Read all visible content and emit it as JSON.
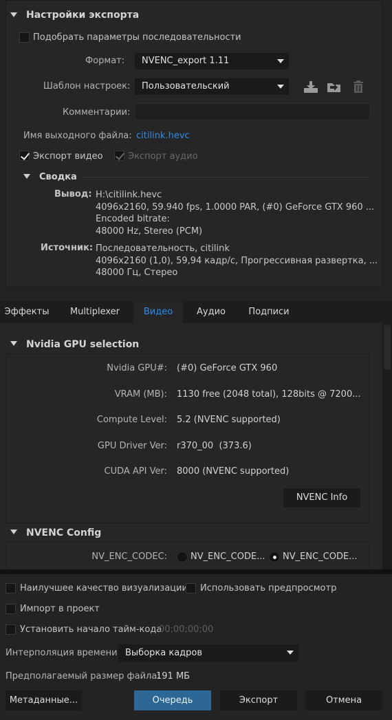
{
  "export_settings": {
    "title": "Настройки экспорта",
    "match_sequence_label": "Подобрать параметры последовательности",
    "format_label": "Формат:",
    "format_value": "NVENC_export 1.11",
    "preset_label": "Шаблон настроек:",
    "preset_value": "Пользовательский",
    "comments_label": "Комментарии:",
    "comments_value": "",
    "output_name_label": "Имя выходного файла:",
    "output_name_value": "citilink.hevc",
    "export_video_label": "Экспорт видео",
    "export_audio_label": "Экспорт аудио"
  },
  "summary": {
    "title": "Сводка",
    "output_label": "Вывод:",
    "output_lines": [
      "H:\\citilink.hevc",
      "4096x2160, 59.940 fps, 1.0000 PAR, (#0) GeForce GTX 960 ...",
      "Encoded bitrate:",
      "48000 Hz, Stereo (PCM)"
    ],
    "source_label": "Источник:",
    "source_lines": [
      "Последовательность, citilink",
      "4096x2160 (1,0), 59,94 кадр/с, Прогрессивная развертка, ...",
      "48000 Гц, Стерео"
    ]
  },
  "tabs": [
    {
      "label": "Эффекты",
      "active": false
    },
    {
      "label": "Multiplexer",
      "active": false
    },
    {
      "label": "Видео",
      "active": true
    },
    {
      "label": "Аудио",
      "active": false
    },
    {
      "label": "Подписи",
      "active": false
    }
  ],
  "gpu_selection": {
    "title": "Nvidia GPU selection",
    "rows": [
      {
        "label": "Nvidia GPU#:",
        "value": "(#0) GeForce GTX 960"
      },
      {
        "label": "VRAM (MB):",
        "value": "1130 free (2048 total), 128bits @ 7200..."
      },
      {
        "label": "Compute Level:",
        "value": "5.2 (NVENC supported)"
      },
      {
        "label": "GPU Driver Ver:",
        "value": "r370_00  (373.6)"
      },
      {
        "label": "CUDA API Ver:",
        "value": "8000 (NVENC supported)"
      }
    ],
    "info_button": "NVENC Info"
  },
  "nvenc_config": {
    "title": "NVENC Config",
    "codec_label": "NV_ENC_CODEC:",
    "codec_option_1": "NV_ENC_CODE...",
    "codec_option_2": "NV_ENC_CODE...",
    "selected_option": 2
  },
  "bottom": {
    "max_render_quality": "Наилучшее качество визуализации",
    "use_previews": "Использовать предпросмотр",
    "import_into_project": "Импорт в проект",
    "set_start_timecode": "Установить начало тайм-кода",
    "timecode_value": "00;00;00;00",
    "time_interpolation_label": "Интерполяция времени:",
    "time_interpolation_value": "Выборка кадров",
    "estimated_size_label": "Предполагаемый размер файла:",
    "estimated_size_value": "191 МБ",
    "metadata_button": "Метаданные...",
    "queue_button": "Очередь",
    "export_button": "Экспорт",
    "cancel_button": "Отмена"
  },
  "colors": {
    "background": "#232323",
    "accent": "#2d8ceb",
    "primary_button": "#2d6796"
  }
}
